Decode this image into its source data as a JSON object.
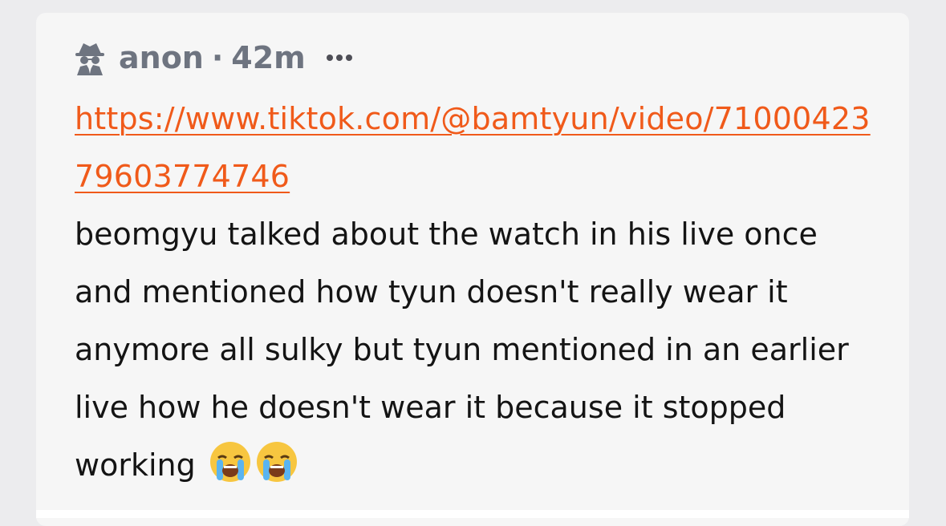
{
  "post": {
    "author": "anon",
    "separator": "·",
    "time": "42m",
    "author_icon": "spy-icon",
    "more_icon": "ellipsis-icon",
    "link_text": "https://www.tiktok.com/@bamtyun/video/7100042379603774746",
    "body": "beomgyu talked about the watch in his live once and mentioned how tyun doesn't really wear it anymore all sulky but tyun mentioned in an earlier live how he doesn't wear it because it stopped working",
    "emojis": [
      "😭",
      "😭"
    ],
    "emoji_icon": "loudly-crying-face-icon"
  },
  "colors": {
    "link": "#f05a1a",
    "meta": "#6e7480",
    "text": "#141414",
    "card_bg": "#f6f6f6"
  }
}
